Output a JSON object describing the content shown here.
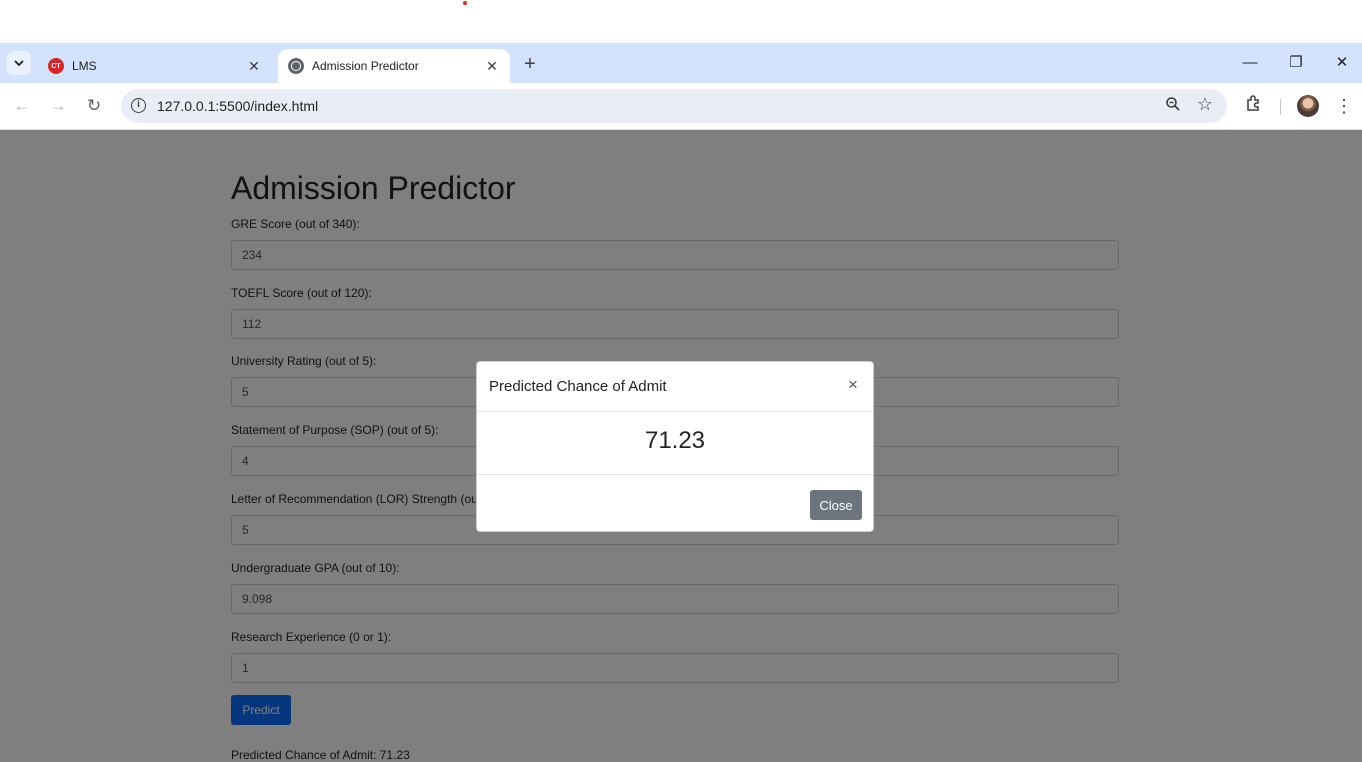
{
  "browser": {
    "tabs": [
      {
        "label": "LMS",
        "favicon": "CT"
      },
      {
        "label": "Admission Predictor"
      }
    ],
    "url": "127.0.0.1:5500/index.html"
  },
  "page": {
    "title": "Admission Predictor",
    "fields": [
      {
        "label": "GRE Score (out of 340):",
        "value": "234"
      },
      {
        "label": "TOEFL Score (out of 120):",
        "value": "112"
      },
      {
        "label": "University Rating (out of 5):",
        "value": "5"
      },
      {
        "label": "Statement of Purpose (SOP) (out of 5):",
        "value": "4"
      },
      {
        "label": "Letter of Recommendation (LOR) Strength (out of 5):",
        "value": "5"
      },
      {
        "label": "Undergraduate GPA (out of 10):",
        "value": "9.098"
      },
      {
        "label": "Research Experience (0 or 1):",
        "value": "1"
      }
    ],
    "predict_label": "Predict",
    "result_text": "Predicted Chance of Admit: 71.23"
  },
  "modal": {
    "title": "Predicted Chance of Admit",
    "value": "71.23",
    "close_label": "Close"
  },
  "colors": {
    "primary": "#0d6efd",
    "secondary": "#6c757d",
    "tab_strip": "#d3e3fd"
  }
}
